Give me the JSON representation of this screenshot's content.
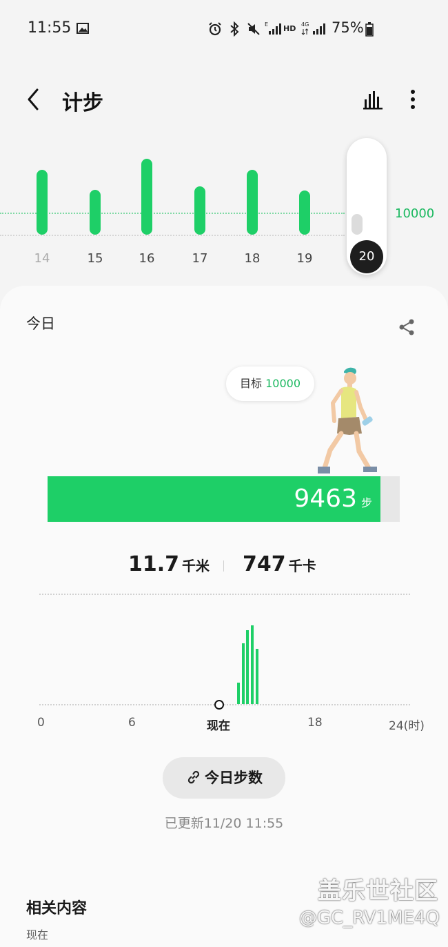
{
  "status_bar": {
    "time": "11:55",
    "battery": "75%",
    "icons": [
      "image-icon",
      "alarm-icon",
      "bluetooth-icon",
      "mute-icon",
      "signal-e-icon",
      "hd-icon",
      "signal-4g-icon",
      "battery-icon"
    ]
  },
  "header": {
    "title": "计步",
    "icons": [
      "back-icon",
      "bar-chart-icon",
      "more-icon"
    ]
  },
  "weekly": {
    "goal_label": "10000",
    "days": [
      {
        "label": "14",
        "steps": 11500,
        "dim": true
      },
      {
        "label": "15",
        "steps": 8000,
        "dim": false
      },
      {
        "label": "16",
        "steps": 13500,
        "dim": false
      },
      {
        "label": "17",
        "steps": 8600,
        "dim": false
      },
      {
        "label": "18",
        "steps": 11500,
        "dim": false
      },
      {
        "label": "19",
        "steps": 7900,
        "dim": false
      }
    ],
    "selected_day": "20",
    "selected_steps": 9463
  },
  "today": {
    "label": "今日",
    "goal_prefix": "目标",
    "goal_value": "10000",
    "steps": "9463",
    "steps_unit": "步",
    "progress_fraction": 0.946,
    "distance": "11.7",
    "distance_unit": "千米",
    "calories": "747",
    "calories_unit": "千卡"
  },
  "hourly": {
    "axis_labels": [
      "0",
      "6",
      "现在",
      "18",
      "24(时)"
    ],
    "bars": [
      {
        "hour": 9.9,
        "rel": 0.27
      },
      {
        "hour": 10.2,
        "rel": 0.77
      },
      {
        "hour": 10.5,
        "rel": 0.94
      },
      {
        "hour": 10.8,
        "rel": 1.0
      },
      {
        "hour": 11.1,
        "rel": 0.7
      }
    ],
    "now_hour": 11.9
  },
  "actions": {
    "link_button": "今日步数",
    "updated": "已更新11/20 11:55"
  },
  "related": {
    "title": "相关内容",
    "subtitle": "现在"
  },
  "watermark": {
    "line1": "盖乐世社区",
    "line2": "@GC_RV1ME4Q"
  },
  "colors": {
    "accent": "#1ecf67",
    "goal_text": "#1ab85f"
  }
}
